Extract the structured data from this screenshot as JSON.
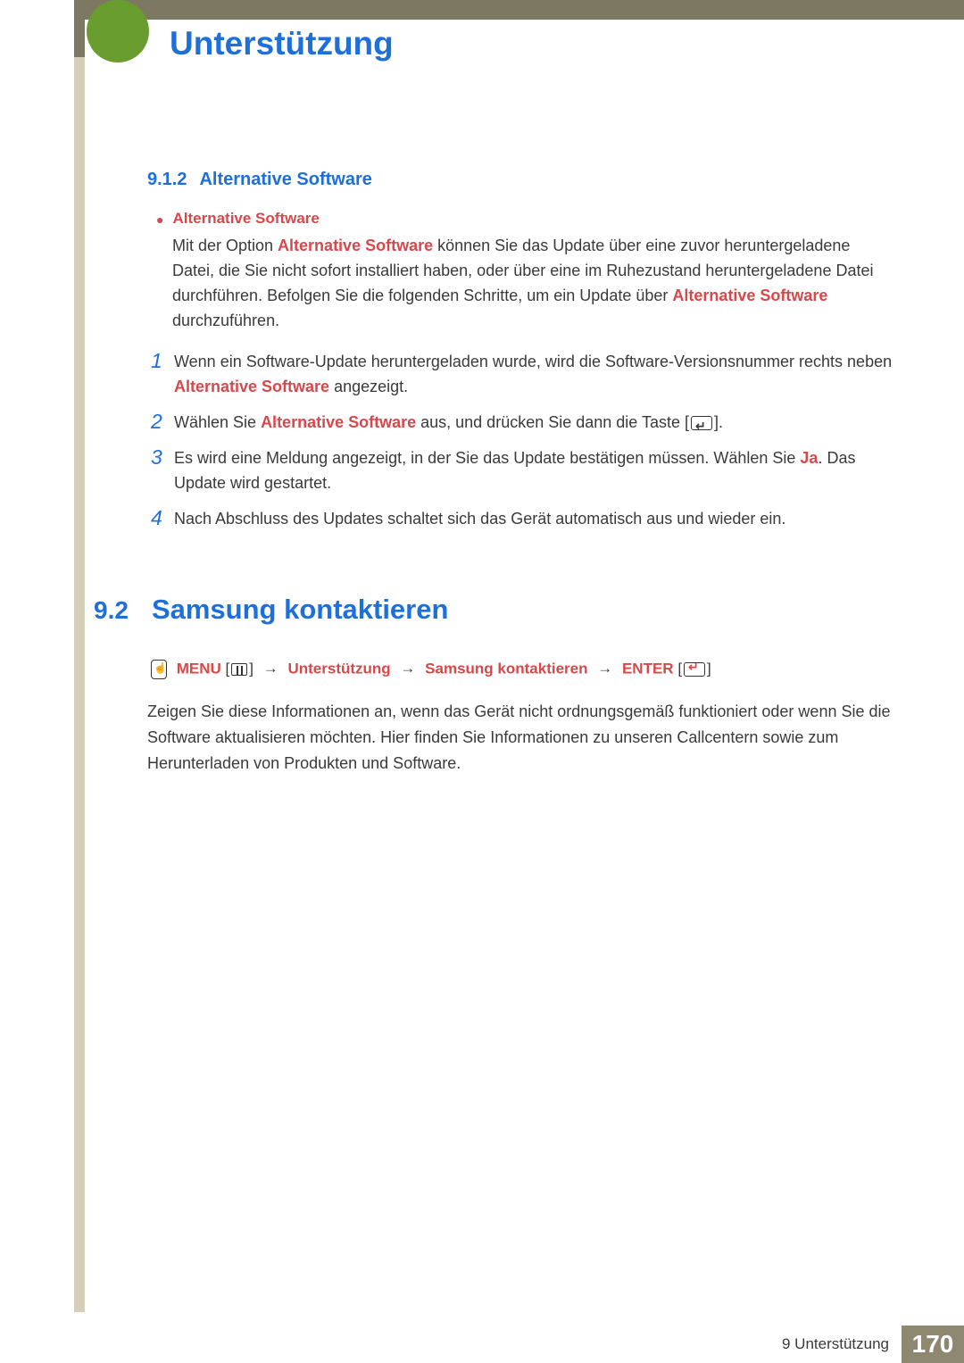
{
  "header": {
    "chapter_title": "Unterstützung"
  },
  "subsection_912": {
    "number": "9.1.2",
    "title": "Alternative Software",
    "bullet_title": "Alternative Software",
    "intro_1": "Mit der Option ",
    "intro_bold_1": "Alternative Software",
    "intro_2": " können Sie das Update über eine zuvor heruntergeladene Datei, die Sie nicht sofort installiert haben, oder über eine im Ruhezustand heruntergeladene Datei durchführen. Befolgen Sie die folgenden Schritte, um ein Update über ",
    "intro_bold_2": "Alternative Software",
    "intro_3": " durchzuführen.",
    "steps": [
      {
        "num": "1",
        "pre": "Wenn ein Software-Update heruntergeladen wurde, wird die Software-Versionsnummer rechts neben ",
        "bold": "Alternative Software",
        "post": " angezeigt."
      },
      {
        "num": "2",
        "pre": "Wählen Sie ",
        "bold": "Alternative Software",
        "post": " aus, und drücken Sie dann die Taste ["
      },
      {
        "num": "3",
        "pre": "Es wird eine Meldung angezeigt, in der Sie das Update bestätigen müssen. Wählen Sie ",
        "bold": "Ja",
        "post": ". Das Update wird gestartet."
      },
      {
        "num": "4",
        "pre": "Nach Abschluss des Updates schaltet sich das Gerät automatisch aus und wieder ein.",
        "bold": "",
        "post": ""
      }
    ]
  },
  "section_92": {
    "number": "9.2",
    "title": "Samsung kontaktieren",
    "nav": {
      "menu": "MENU",
      "p1": "Unterstützung",
      "p2": "Samsung kontaktieren",
      "enter": "ENTER"
    },
    "body": "Zeigen Sie diese Informationen an, wenn das Gerät nicht ordnungsgemäß funktioniert oder wenn Sie die Software aktualisieren möchten. Hier finden Sie Informationen zu unseren Callcentern sowie zum Herunterladen von Produkten und Software."
  },
  "footer": {
    "label": "9 Unterstützung",
    "page": "170"
  }
}
